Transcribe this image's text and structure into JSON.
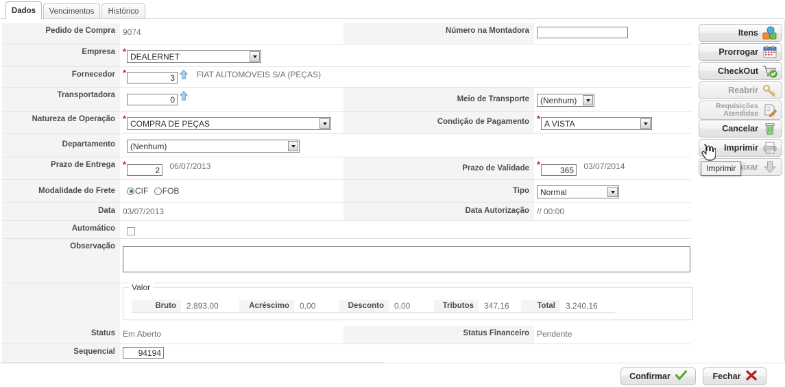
{
  "tabs": [
    {
      "label": "Dados",
      "active": true
    },
    {
      "label": "Vencimentos",
      "active": false
    },
    {
      "label": "Histórico",
      "active": false
    }
  ],
  "form": {
    "pedido_de_compra": {
      "label": "Pedido de Compra",
      "value": "9074"
    },
    "numero_na_montadora": {
      "label": "Número na Montadora",
      "value": ""
    },
    "empresa": {
      "label": "Empresa",
      "value": "DEALERNET",
      "required": true
    },
    "fornecedor": {
      "label": "Fornecedor",
      "code": "3",
      "name": "FIAT AUTOMOVEIS S/A (PEÇAS)",
      "required": true
    },
    "transportadora": {
      "label": "Transportadora",
      "code": "0",
      "required": false
    },
    "meio_de_transporte": {
      "label": "Meio de Transporte",
      "value": "(Nenhum)"
    },
    "natureza_de_operacao": {
      "label": "Natureza de Operação",
      "value": "COMPRA DE PEÇAS",
      "required": true
    },
    "condicao_de_pagamento": {
      "label": "Condição de Pagamento",
      "value": "A VISTA",
      "required": true
    },
    "departamento": {
      "label": "Departamento",
      "value": "(Nenhum)"
    },
    "prazo_de_entrega": {
      "label": "Prazo de Entrega",
      "days": "2",
      "date": "06/07/2013",
      "required": true
    },
    "prazo_de_validade": {
      "label": "Prazo de Validade",
      "days": "365",
      "date": "03/07/2014",
      "required": true
    },
    "modalidade_do_frete": {
      "label": "Modalidade do Frete",
      "options": [
        "CIF",
        "FOB"
      ],
      "selected": "CIF"
    },
    "tipo": {
      "label": "Tipo",
      "value": "Normal"
    },
    "data": {
      "label": "Data",
      "value": "03/07/2013"
    },
    "data_autorizacao": {
      "label": "Data Autorização",
      "value": "// 00:00"
    },
    "automatico": {
      "label": "Automático",
      "checked": false
    },
    "observacao": {
      "label": "Observação",
      "value": ""
    },
    "status": {
      "label": "Status",
      "value": "Em Aberto"
    },
    "status_financeiro": {
      "label": "Status Financeiro",
      "value": "Pendente"
    },
    "sequencial": {
      "label": "Sequencial",
      "value": "94194"
    }
  },
  "valor": {
    "legend": "Valor",
    "cells": [
      {
        "label": "Bruto",
        "value": "2.893,00"
      },
      {
        "label": "Acréscimo",
        "value": "0,00"
      },
      {
        "label": "Desconto",
        "value": "0,00"
      },
      {
        "label": "Tributos",
        "value": "347,16"
      },
      {
        "label": "Total",
        "value": "3.240,16"
      }
    ]
  },
  "side_buttons": [
    {
      "label": "Itens",
      "icon": "blocks-icon",
      "disabled": false
    },
    {
      "label": "Prorrogar",
      "icon": "calendar-icon",
      "disabled": false
    },
    {
      "label": "CheckOut",
      "icon": "cart-check-icon",
      "disabled": false
    },
    {
      "label": "Reabrir",
      "icon": "key-wrench-icon",
      "disabled": true
    },
    {
      "label": "Requisições\nAtendidas",
      "icon": "document-edit-icon",
      "disabled": true
    },
    {
      "label": "Cancelar",
      "icon": "trash-icon",
      "disabled": false
    },
    {
      "label": "Imprimir",
      "icon": "printer-icon",
      "disabled": false
    },
    {
      "label": "Baixar",
      "icon": "down-arrow-icon",
      "disabled": true
    }
  ],
  "tooltip": {
    "text": "Imprimir"
  },
  "footer_buttons": [
    {
      "label": "Confirmar",
      "icon": "check-icon"
    },
    {
      "label": "Fechar",
      "icon": "x-icon"
    }
  ],
  "colors": {
    "required_asterisk": "#d01a1a",
    "label_bg": "#f4f4f4",
    "confirm_check": "#5aa82e",
    "close_x": "#b81c1c",
    "radio_dot": "#2f8a2f"
  }
}
